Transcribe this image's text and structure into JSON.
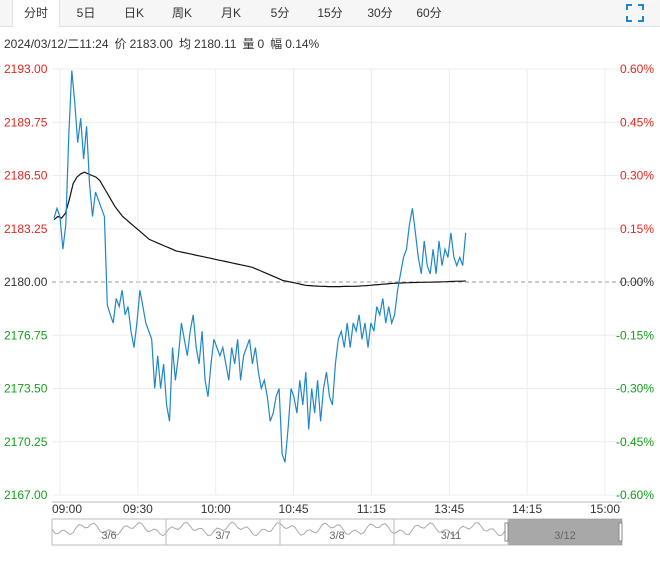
{
  "tabs": [
    {
      "label": "分时",
      "active": true
    },
    {
      "label": "5日",
      "active": false
    },
    {
      "label": "日K",
      "active": false
    },
    {
      "label": "周K",
      "active": false
    },
    {
      "label": "月K",
      "active": false
    },
    {
      "label": "5分",
      "active": false
    },
    {
      "label": "15分",
      "active": false
    },
    {
      "label": "30分",
      "active": false
    },
    {
      "label": "60分",
      "active": false
    }
  ],
  "info": {
    "datetime": "2024/03/12/二11:24",
    "price_label": "价",
    "price": "2183.00",
    "avg_label": "均",
    "avg": "2180.11",
    "volume_label": "量",
    "volume": "0",
    "amplitude_label": "幅",
    "amplitude": "0.14%"
  },
  "colors": {
    "price_line": "#1f87c8",
    "avg_line": "#111111",
    "up": "#e0281f",
    "down": "#14a01a",
    "grid": "#ececec",
    "navigator_selected": "#999999"
  },
  "chart_data": {
    "type": "line",
    "title": "",
    "xlabel": "",
    "ylabel": "",
    "prev_close": 2180.0,
    "ylim": [
      2167.0,
      2193.0
    ],
    "y_ticks_left": [
      "2193.00",
      "2189.75",
      "2186.50",
      "2183.25",
      "2180.00",
      "2176.75",
      "2173.50",
      "2170.25",
      "2167.00"
    ],
    "y_ticks_right": [
      "0.60%",
      "0.45%",
      "0.30%",
      "0.15%",
      "0.00%",
      "-0.15%",
      "-0.30%",
      "-0.45%",
      "-0.60%"
    ],
    "x_ticks": [
      "09:00",
      "09:30",
      "10:00",
      "10:45",
      "11:15",
      "13:45",
      "14:15",
      "15:00"
    ],
    "series": [
      {
        "values": [
          2183.9,
          2184.5,
          2184.0,
          2182.0,
          2183.5,
          2189.0,
          2192.9,
          2191.0,
          2188.5,
          2190.0,
          2187.5,
          2189.5,
          2186.0,
          2184.0,
          2185.5,
          2185.0,
          2184.5,
          2184.0,
          2178.6,
          2178.0,
          2177.5,
          2179.0,
          2178.5,
          2179.5,
          2178.0,
          2178.5,
          2177.0,
          2176.0,
          2177.5,
          2179.5,
          2178.5,
          2177.5,
          2177.0,
          2176.5,
          2173.5,
          2175.5,
          2173.5,
          2175.0,
          2172.5,
          2171.5,
          2176.0,
          2174.0,
          2175.5,
          2177.5,
          2176.5,
          2175.5,
          2177.0,
          2178.0,
          2176.0,
          2175.0,
          2177.0,
          2174.0,
          2173.0,
          2175.0,
          2176.5,
          2176.0,
          2175.5,
          2176.0,
          2175.0,
          2174.0,
          2176.0,
          2175.0,
          2176.5,
          2174.0,
          2175.5,
          2176.0,
          2176.5,
          2175.0,
          2176.0,
          2174.5,
          2173.5,
          2174.0,
          2173.0,
          2171.5,
          2172.0,
          2173.0,
          2173.5,
          2169.5,
          2169.0,
          2171.0,
          2173.5,
          2173.0,
          2172.0,
          2174.0,
          2172.5,
          2174.5,
          2171.0,
          2173.5,
          2172.0,
          2174.0,
          2171.5,
          2173.5,
          2174.5,
          2173.0,
          2172.5,
          2175.0,
          2176.5,
          2177.0,
          2176.0,
          2177.5,
          2176.0,
          2177.5,
          2177.0,
          2178.0,
          2176.5,
          2177.5,
          2176.0,
          2177.5,
          2177.0,
          2178.5,
          2178.0,
          2179.0,
          2177.5,
          2178.5,
          2177.5,
          2178.0,
          2179.5,
          2180.5,
          2181.5,
          2182.0,
          2183.5,
          2184.5,
          2183.0,
          2181.5,
          2180.5,
          2182.5,
          2181.0,
          2180.5,
          2182.0,
          2180.5,
          2182.5,
          2181.0,
          2182.0,
          2181.5,
          2183.0,
          2181.5,
          2181.0,
          2181.5,
          2181.0,
          2183.0
        ],
        "name": ""
      },
      {
        "values": [
          2183.8,
          2184.0,
          2183.9,
          2184.2,
          2185.0,
          2186.0,
          2186.4,
          2186.6,
          2186.7,
          2186.6,
          2186.5,
          2186.4,
          2186.2,
          2185.8,
          2185.4,
          2185.0,
          2184.6,
          2184.3,
          2184.0,
          2183.8,
          2183.6,
          2183.4,
          2183.2,
          2183.0,
          2182.8,
          2182.6,
          2182.5,
          2182.4,
          2182.3,
          2182.2,
          2182.1,
          2182.0,
          2181.9,
          2181.85,
          2181.8,
          2181.75,
          2181.7,
          2181.65,
          2181.6,
          2181.55,
          2181.5,
          2181.45,
          2181.4,
          2181.35,
          2181.3,
          2181.25,
          2181.2,
          2181.15,
          2181.1,
          2181.05,
          2181.0,
          2180.95,
          2180.9,
          2180.8,
          2180.7,
          2180.6,
          2180.5,
          2180.4,
          2180.3,
          2180.2,
          2180.1,
          2180.05,
          2180.0,
          2179.95,
          2179.9,
          2179.85,
          2179.8,
          2179.78,
          2179.76,
          2179.75,
          2179.74,
          2179.73,
          2179.72,
          2179.72,
          2179.72,
          2179.72,
          2179.73,
          2179.73,
          2179.74,
          2179.74,
          2179.75,
          2179.77,
          2179.78,
          2179.8,
          2179.82,
          2179.84,
          2179.86,
          2179.88,
          2179.9,
          2179.92,
          2179.93,
          2179.94,
          2179.95,
          2179.96,
          2179.97,
          2179.97,
          2179.98,
          2179.98,
          2179.99,
          2179.99,
          2180.0,
          2180.0,
          2180.01,
          2180.02,
          2180.03,
          2180.04,
          2180.05,
          2180.05,
          2180.06
        ],
        "name": ""
      }
    ]
  },
  "navigator": {
    "labels": [
      "3/6",
      "3/7",
      "3/8",
      "3/11",
      "3/12"
    ]
  }
}
